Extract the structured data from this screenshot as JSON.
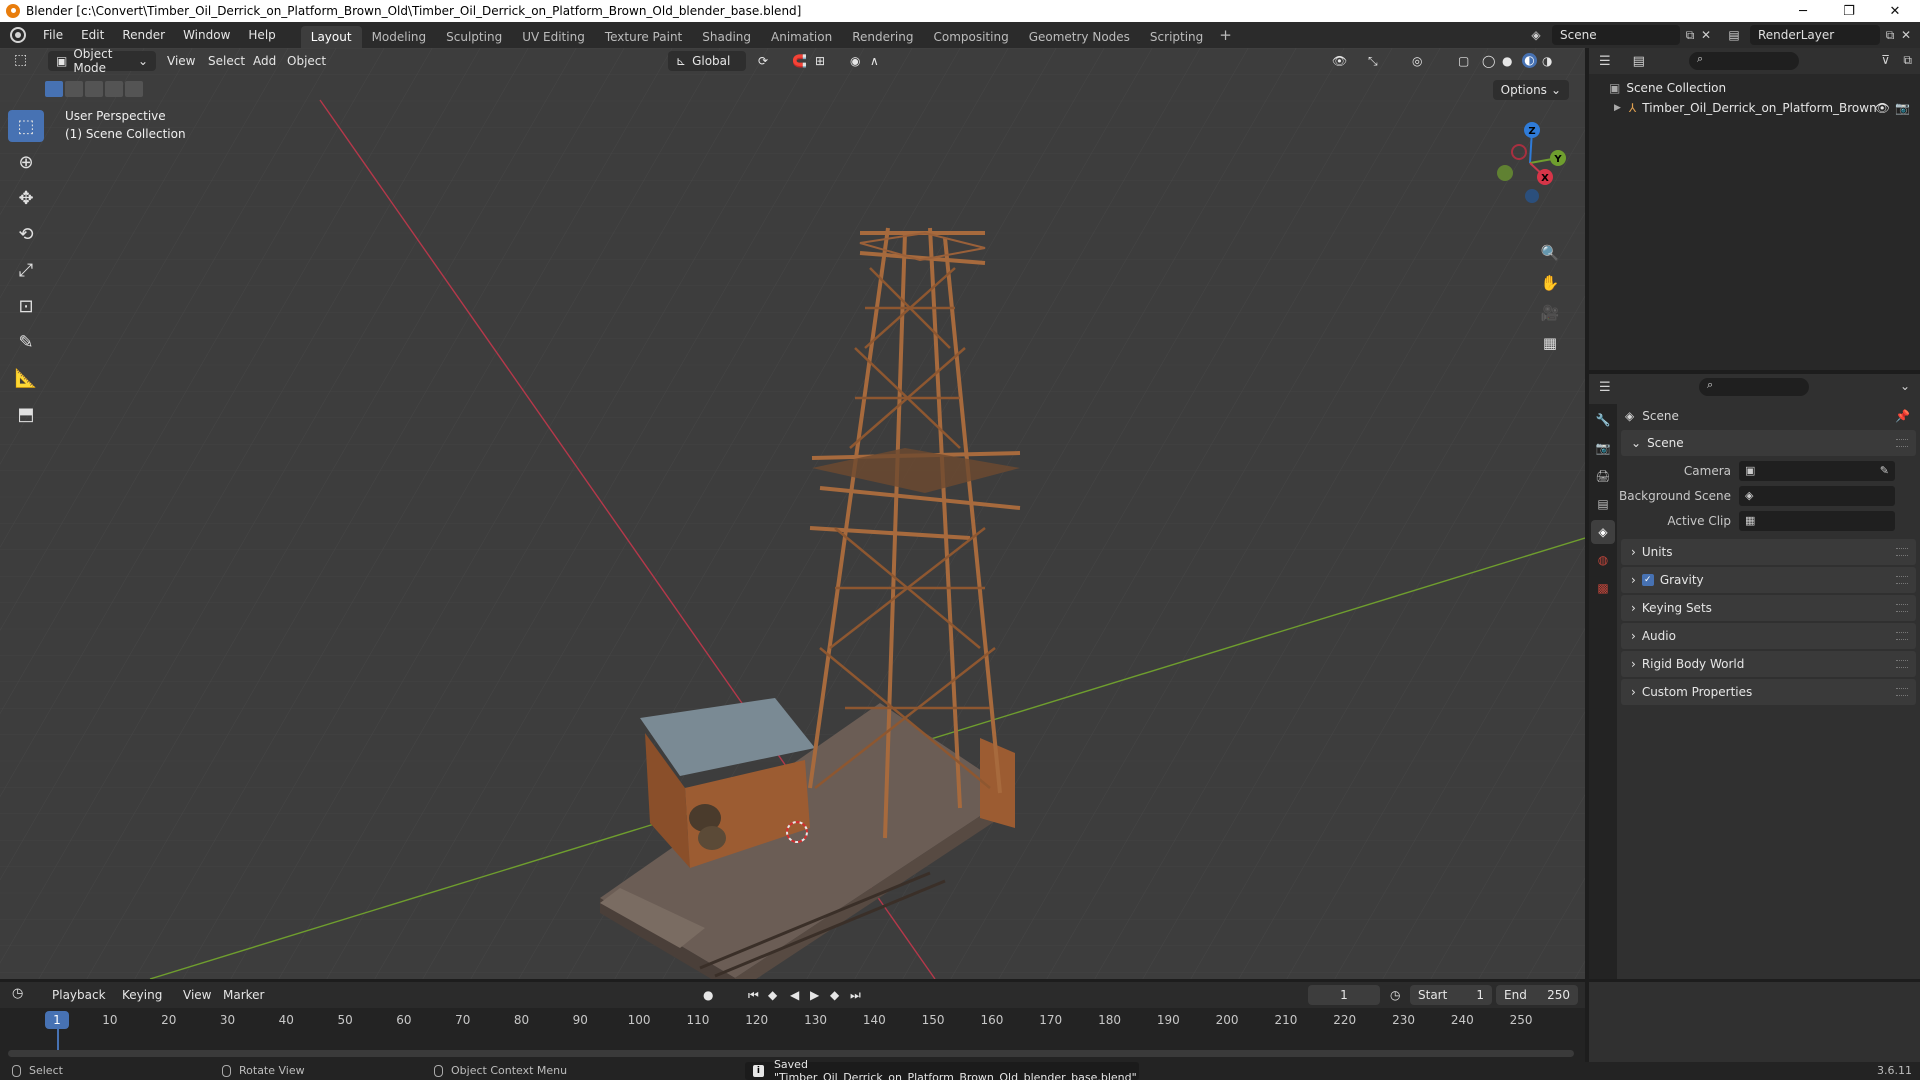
{
  "window": {
    "title": "Blender [c:\\Convert\\Timber_Oil_Derrick_on_Platform_Brown_Old\\Timber_Oil_Derrick_on_Platform_Brown_Old_blender_base.blend]",
    "minimize": "─",
    "maximize": "❐",
    "close": "✕"
  },
  "menu": {
    "items": [
      "File",
      "Edit",
      "Render",
      "Window",
      "Help"
    ],
    "workspaces": [
      "Layout",
      "Modeling",
      "Sculpting",
      "UV Editing",
      "Texture Paint",
      "Shading",
      "Animation",
      "Rendering",
      "Compositing",
      "Geometry Nodes",
      "Scripting"
    ],
    "add_workspace": "+",
    "scene": "Scene",
    "view_layer": "RenderLayer"
  },
  "viewport": {
    "mode": "Object Mode",
    "menus": [
      "View",
      "Select",
      "Add",
      "Object"
    ],
    "orientation": "Global",
    "options": "Options",
    "overlay_line1": "User Perspective",
    "overlay_line2": "(1) Scene Collection",
    "axes": {
      "x": "X",
      "y": "Y",
      "z": "Z"
    }
  },
  "outliner": {
    "root": "Scene Collection",
    "object": "Timber_Oil_Derrick_on_Platform_Brown"
  },
  "properties": {
    "header": "Scene",
    "panel_scene": "Scene",
    "camera_label": "Camera",
    "background_label": "Background Scene",
    "clip_label": "Active Clip",
    "panels": [
      "Units",
      "Gravity",
      "Keying Sets",
      "Audio",
      "Rigid Body World",
      "Custom Properties"
    ],
    "gravity_checked": true
  },
  "timeline": {
    "menus": [
      "Playback",
      "Keying",
      "View",
      "Marker"
    ],
    "current_frame": "1",
    "start_label": "Start",
    "start": "1",
    "end_label": "End",
    "end": "250",
    "ticks": [
      "1",
      "10",
      "20",
      "30",
      "40",
      "50",
      "60",
      "70",
      "80",
      "90",
      "100",
      "110",
      "120",
      "130",
      "140",
      "150",
      "160",
      "170",
      "180",
      "190",
      "200",
      "210",
      "220",
      "230",
      "240",
      "250"
    ]
  },
  "status": {
    "select": "Select",
    "rotate": "Rotate View",
    "context": "Object Context Menu",
    "saved": "Saved \"Timber_Oil_Derrick_on_Platform_Brown_Old_blender_base.blend\"",
    "version": "3.6.11"
  }
}
